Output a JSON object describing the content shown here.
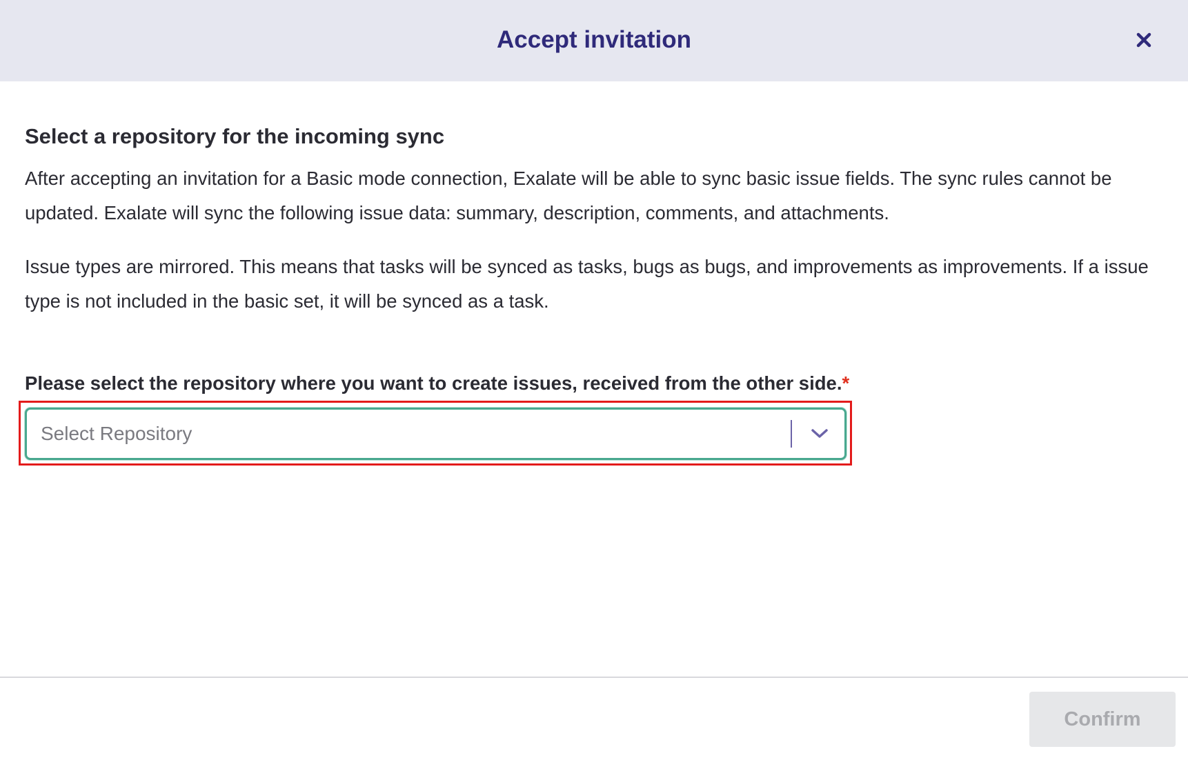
{
  "header": {
    "title": "Accept invitation",
    "close_icon": "close-icon"
  },
  "body": {
    "heading": "Select a repository for the incoming sync",
    "paragraph_1": "After accepting an invitation for a Basic mode connection, Exalate will be able to sync basic issue fields. The sync rules cannot be updated. Exalate will sync the following issue data: summary, description, comments, and attachments.",
    "paragraph_2": "Issue types are mirrored. This means that tasks will be synced as tasks, bugs as bugs, and improvements as improvements. If a issue type is not included in the basic set, it will be synced as a task.",
    "field_label": "Please select the repository where you want to create issues, received from the other side.",
    "required_marker": "*",
    "repository_select": {
      "placeholder": "Select Repository",
      "icon": "chevron-down-icon"
    }
  },
  "footer": {
    "confirm_label": "Confirm",
    "confirm_disabled": true
  },
  "colors": {
    "header_bg": "#e6e7f0",
    "title": "#2f2a7a",
    "select_border": "#49a88f",
    "required": "#e0301e",
    "highlight": "#e31b1b",
    "confirm_bg": "#e6e7e9"
  }
}
